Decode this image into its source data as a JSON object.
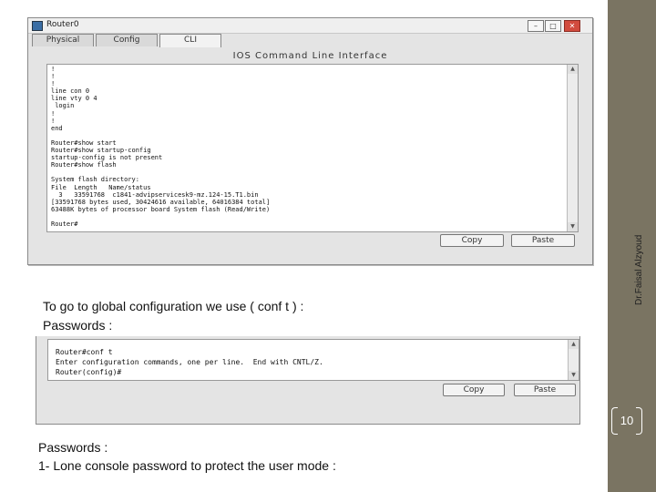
{
  "sidebar": {
    "author": "Dr.Faisal Alzyoud",
    "page_number": "10"
  },
  "window": {
    "title": "Router0",
    "tabs": [
      "Physical",
      "Config",
      "CLI"
    ],
    "active_tab": "CLI",
    "heading": "IOS Command Line Interface",
    "console_lines": [
      "!",
      "!",
      "!",
      "line con 0",
      "line vty 0 4",
      " login",
      "!",
      "!",
      "end",
      "",
      "Router#show start",
      "Router#show startup-config",
      "startup-config is not present",
      "Router#show flash",
      "",
      "System flash directory:",
      "File  Length   Name/status",
      "  3   33591768  c1841-advipservicesk9-mz.124-15.T1.bin",
      "[33591768 bytes used, 30424616 available, 64016384 total]",
      "63488K bytes of processor board System flash (Read/Write)",
      "",
      "Router#"
    ],
    "copy_label": "Copy",
    "paste_label": "Paste"
  },
  "text": {
    "line1": "To go to global configuration we use ( conf t ) :",
    "line2": "Passwords :"
  },
  "window2": {
    "console_lines": [
      "Router#conf t",
      "Enter configuration commands, one per line.  End with CNTL/Z.",
      "Router(config)#"
    ],
    "copy_label": "Copy",
    "paste_label": "Paste"
  },
  "bottom": {
    "line1": "Passwords :",
    "line2": "1- Lone console password to protect the user mode :"
  }
}
